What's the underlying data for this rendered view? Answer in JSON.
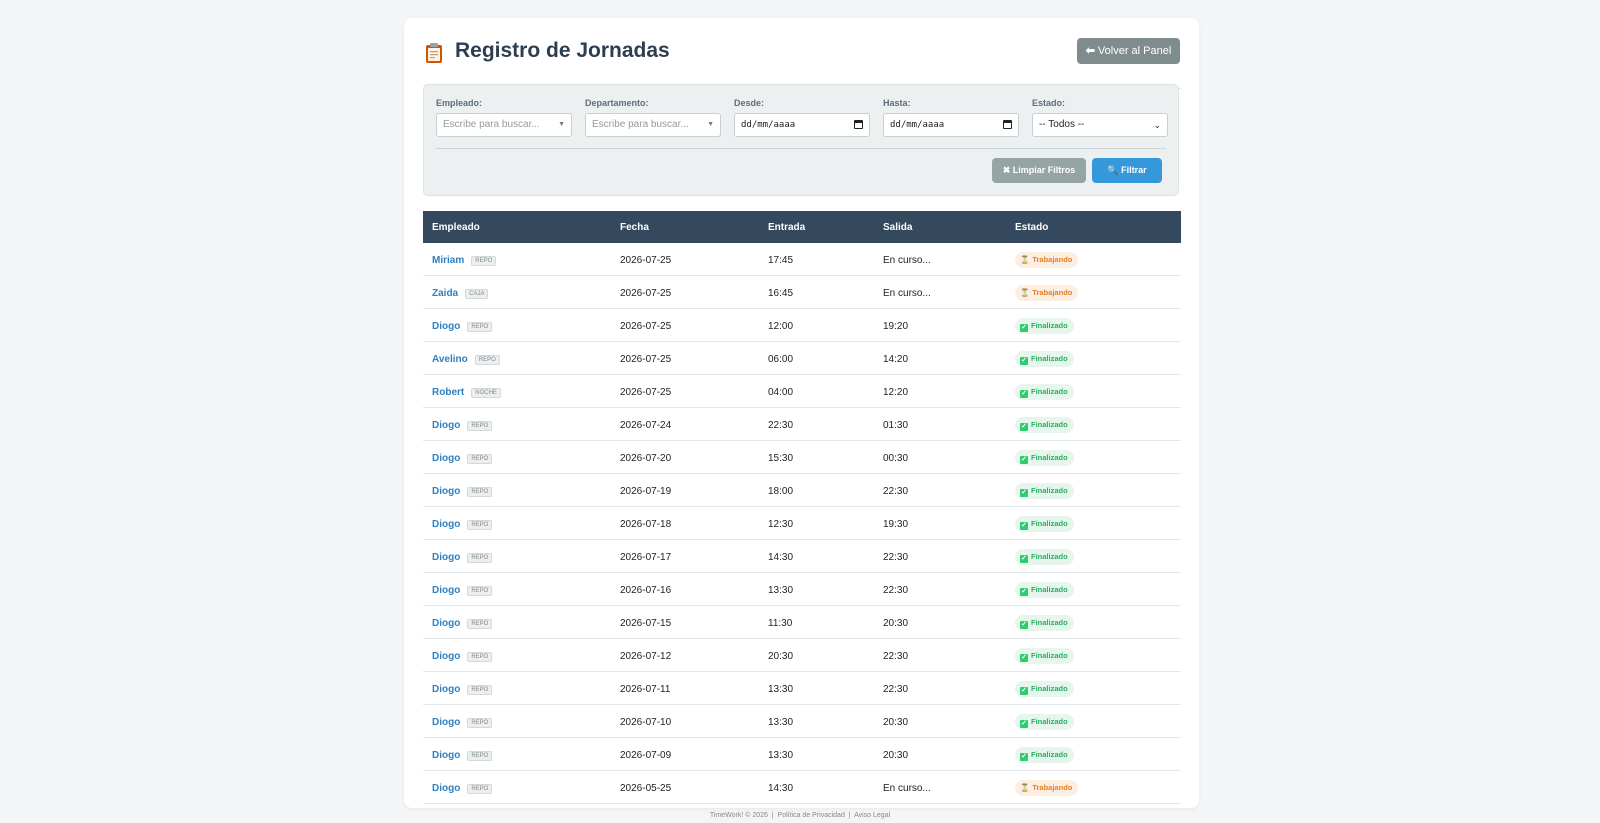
{
  "page": {
    "title": "Registro de Jornadas",
    "back_button": "Volver al Panel"
  },
  "filters": {
    "employee": {
      "label": "Empleado:",
      "placeholder": "Escribe para buscar..."
    },
    "department": {
      "label": "Departamento:",
      "placeholder": "Escribe para buscar..."
    },
    "from": {
      "label": "Desde:",
      "value": "dd/mm/aaaa"
    },
    "to": {
      "label": "Hasta:",
      "value": "dd/mm/aaaa"
    },
    "status": {
      "label": "Estado:",
      "value": "-- Todos --"
    },
    "clear_button": "Limpiar Filtros",
    "filter_button": "Filtrar"
  },
  "table": {
    "headers": [
      "Empleado",
      "Fecha",
      "Entrada",
      "Salida",
      "Estado"
    ],
    "rows": [
      {
        "name": "Miriam",
        "dept": "REPO",
        "date": "2026-07-25",
        "in": "17:45",
        "out": "En curso...",
        "status": "Trabajando",
        "kind": "working"
      },
      {
        "name": "Zaida",
        "dept": "CAJA",
        "date": "2026-07-25",
        "in": "16:45",
        "out": "En curso...",
        "status": "Trabajando",
        "kind": "working"
      },
      {
        "name": "Diogo",
        "dept": "REPO",
        "date": "2026-07-25",
        "in": "12:00",
        "out": "19:20",
        "status": "Finalizado",
        "kind": "done"
      },
      {
        "name": "Avelino",
        "dept": "REPO",
        "date": "2026-07-25",
        "in": "06:00",
        "out": "14:20",
        "status": "Finalizado",
        "kind": "done"
      },
      {
        "name": "Robert",
        "dept": "NOCHE",
        "date": "2026-07-25",
        "in": "04:00",
        "out": "12:20",
        "status": "Finalizado",
        "kind": "done"
      },
      {
        "name": "Diogo",
        "dept": "REPO",
        "date": "2026-07-24",
        "in": "22:30",
        "out": "01:30",
        "status": "Finalizado",
        "kind": "done"
      },
      {
        "name": "Diogo",
        "dept": "REPO",
        "date": "2026-07-20",
        "in": "15:30",
        "out": "00:30",
        "status": "Finalizado",
        "kind": "done"
      },
      {
        "name": "Diogo",
        "dept": "REPO",
        "date": "2026-07-19",
        "in": "18:00",
        "out": "22:30",
        "status": "Finalizado",
        "kind": "done"
      },
      {
        "name": "Diogo",
        "dept": "REPO",
        "date": "2026-07-18",
        "in": "12:30",
        "out": "19:30",
        "status": "Finalizado",
        "kind": "done"
      },
      {
        "name": "Diogo",
        "dept": "REPO",
        "date": "2026-07-17",
        "in": "14:30",
        "out": "22:30",
        "status": "Finalizado",
        "kind": "done"
      },
      {
        "name": "Diogo",
        "dept": "REPO",
        "date": "2026-07-16",
        "in": "13:30",
        "out": "22:30",
        "status": "Finalizado",
        "kind": "done"
      },
      {
        "name": "Diogo",
        "dept": "REPO",
        "date": "2026-07-15",
        "in": "11:30",
        "out": "20:30",
        "status": "Finalizado",
        "kind": "done"
      },
      {
        "name": "Diogo",
        "dept": "REPO",
        "date": "2026-07-12",
        "in": "20:30",
        "out": "22:30",
        "status": "Finalizado",
        "kind": "done"
      },
      {
        "name": "Diogo",
        "dept": "REPO",
        "date": "2026-07-11",
        "in": "13:30",
        "out": "22:30",
        "status": "Finalizado",
        "kind": "done"
      },
      {
        "name": "Diogo",
        "dept": "REPO",
        "date": "2026-07-10",
        "in": "13:30",
        "out": "20:30",
        "status": "Finalizado",
        "kind": "done"
      },
      {
        "name": "Diogo",
        "dept": "REPO",
        "date": "2026-07-09",
        "in": "13:30",
        "out": "20:30",
        "status": "Finalizado",
        "kind": "done"
      },
      {
        "name": "Diogo",
        "dept": "REPO",
        "date": "2026-05-25",
        "in": "14:30",
        "out": "En curso...",
        "status": "Trabajando",
        "kind": "working"
      }
    ]
  },
  "footer": {
    "copyright": "TimeWork! © 2026",
    "privacy": "Política de Privacidad",
    "legal": "Aviso Legal"
  },
  "colors": {
    "header": "#34495e",
    "primary": "#3498db",
    "link": "#2f80c0",
    "working": "#e67e22",
    "done": "#27ae60"
  },
  "icons": {
    "title": "clipboard-icon",
    "back": "arrow-left-icon",
    "clear": "x-icon",
    "filter": "search-icon",
    "working": "hourglass-icon",
    "done": "check-box-icon"
  }
}
